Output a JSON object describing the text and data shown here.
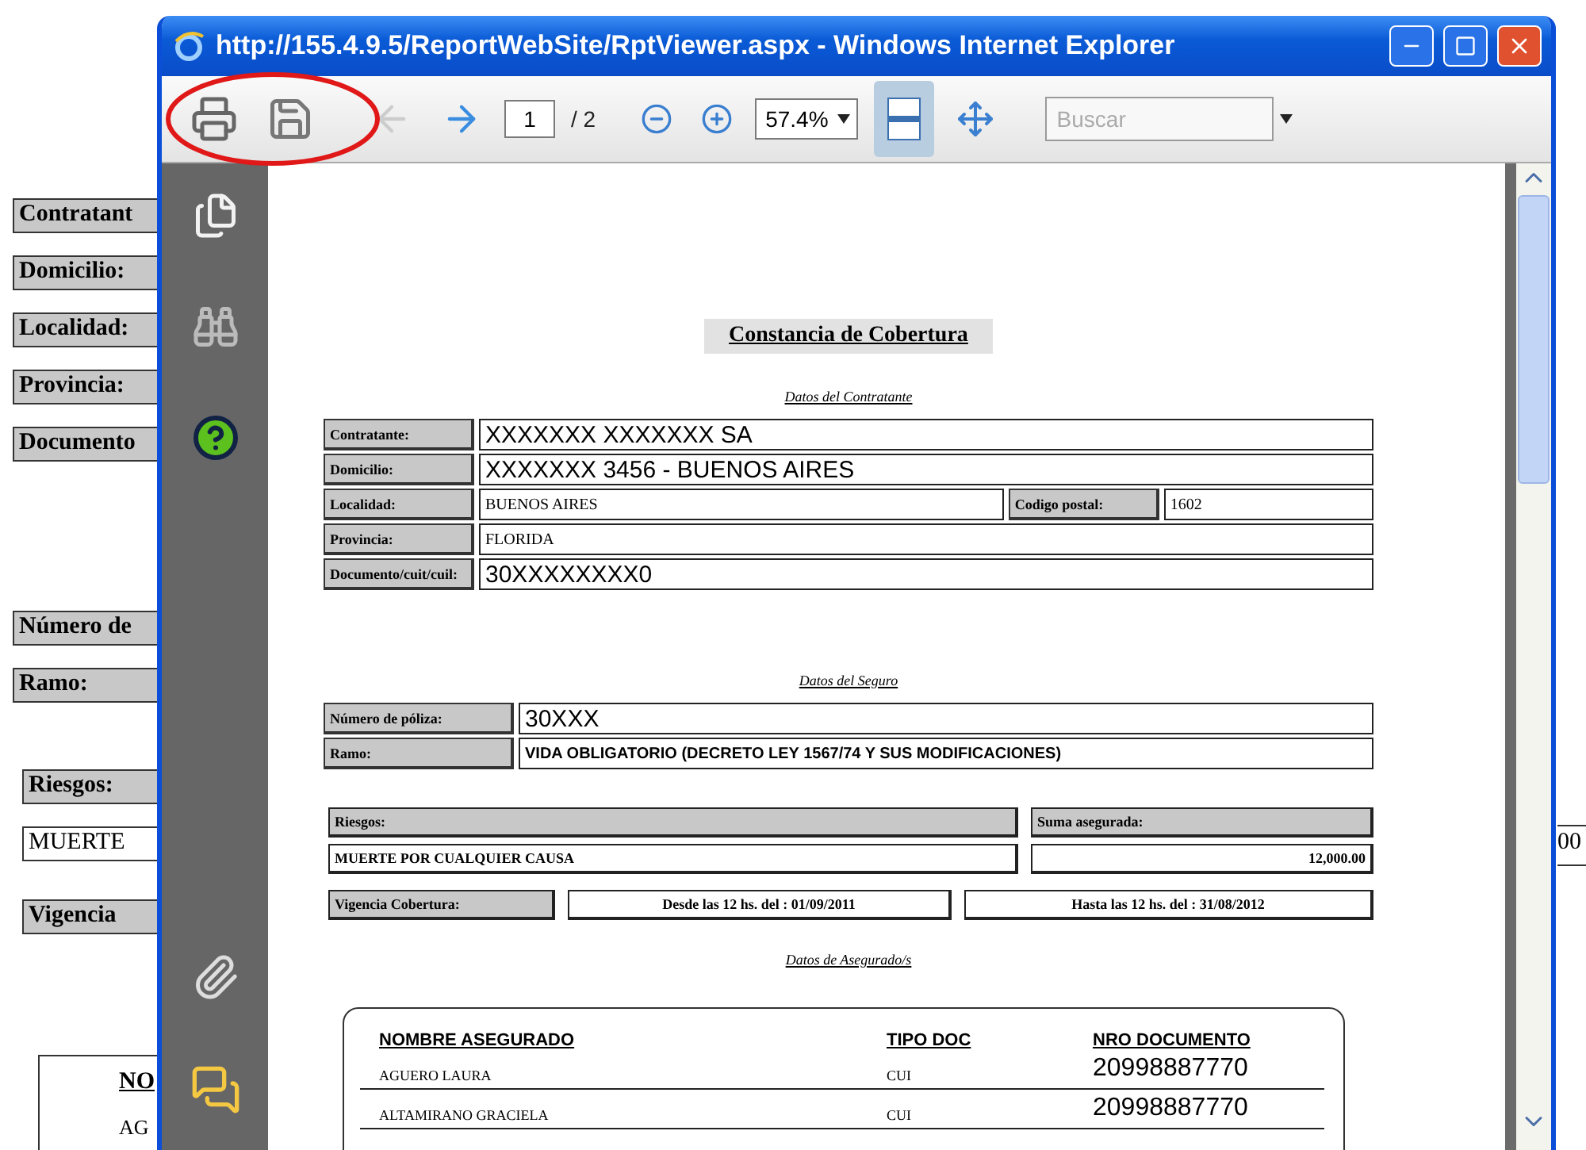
{
  "background_page": {
    "contract_labels": [
      "Contratant",
      "Domicilio:",
      "Localidad:",
      "Provincia:",
      "Documento"
    ],
    "policy_labels": [
      "Número de",
      "Ramo:"
    ],
    "risk_label": "Riesgos:",
    "risk_value": "MUERTE",
    "vigencia_label": "Vigencia",
    "insured_header": "NO",
    "insured_cell": "AG",
    "right_cell": "00"
  },
  "window": {
    "title": "http://155.4.9.5/ReportWebSite/RptViewer.aspx - Windows Internet Explorer"
  },
  "toolbar": {
    "page": "1",
    "page_total": "/ 2",
    "zoom": "57.4%",
    "search_placeholder": "Buscar"
  },
  "report": {
    "title": "Constancia de Cobertura",
    "contract": {
      "heading": "Datos del Contratante",
      "rows": [
        [
          {
            "label": "Contratante:",
            "value": "XXXXXXX XXXXXXX SA",
            "kind": "sans"
          }
        ],
        [
          {
            "label": "Domicilio:",
            "value": "XXXXXXX 3456 - BUENOS AIRES",
            "kind": "sans"
          }
        ],
        [
          {
            "label": "Localidad:",
            "value": "BUENOS AIRES",
            "kind": "serif"
          },
          {
            "label": "Codigo postal:",
            "value": "1602",
            "kind": "serif"
          }
        ],
        [
          {
            "label": "Provincia:",
            "value": "FLORIDA",
            "kind": "serif"
          }
        ],
        [
          {
            "label": "Documento/cuit/cuil:",
            "value": "30XXXXXXXX0",
            "kind": "sans"
          }
        ]
      ]
    },
    "policy": {
      "heading": "Datos del Seguro",
      "rows": [
        [
          {
            "label": "Número de póliza:",
            "value": "30XXX",
            "kind": "sans"
          }
        ],
        [
          {
            "label": "Ramo:",
            "value": "VIDA OBLIGATORIO (DECRETO LEY 1567/74 Y SUS MODIFICACIONES)",
            "kind": "bold"
          }
        ]
      ]
    },
    "risk": {
      "risk_label": "Riesgos:",
      "sum_label": "Suma asegurada:",
      "risk_value": "MUERTE POR CUALQUIER CAUSA",
      "sum_value": "12,000.00",
      "vigencia_label": "Vigencia Cobertura:",
      "from": "Desde las 12 hs. del : 01/09/2011",
      "to": "Hasta las 12 hs. del : 31/08/2012"
    },
    "insured": {
      "heading": "Datos de Asegurado/s",
      "columns": [
        "NOMBRE ASEGURADO",
        "TIPO DOC",
        "NRO DOCUMENTO"
      ],
      "rows": [
        [
          "AGUERO LAURA",
          "CUI",
          "20998887770"
        ],
        [
          "ALTAMIRANO GRACIELA",
          "CUI",
          "20998887770"
        ]
      ]
    }
  }
}
